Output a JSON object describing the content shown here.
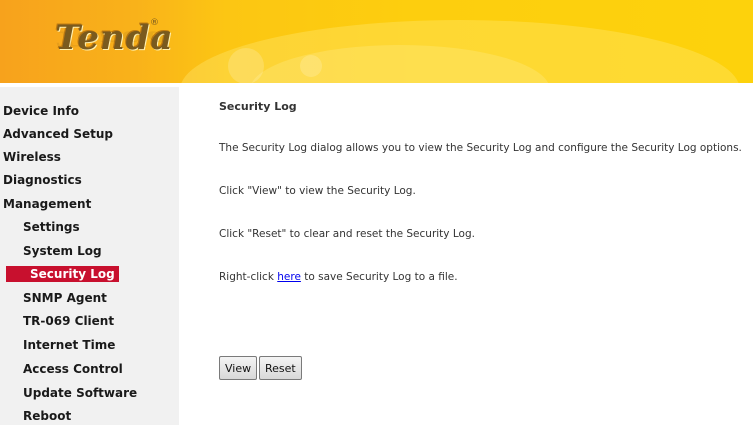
{
  "brand": {
    "logo_text": "Tenda",
    "logo_mark": "®"
  },
  "sidebar": {
    "items": [
      {
        "label": "Device Info",
        "level": "top"
      },
      {
        "label": "Advanced Setup",
        "level": "top"
      },
      {
        "label": "Wireless",
        "level": "top"
      },
      {
        "label": "Diagnostics",
        "level": "top"
      },
      {
        "label": "Management",
        "level": "top"
      },
      {
        "label": "Settings",
        "level": "sub"
      },
      {
        "label": "System Log",
        "level": "sub"
      },
      {
        "label": "Security Log",
        "level": "sub",
        "active": true
      },
      {
        "label": "SNMP Agent",
        "level": "sub"
      },
      {
        "label": "TR-069 Client",
        "level": "sub"
      },
      {
        "label": "Internet Time",
        "level": "sub"
      },
      {
        "label": "Access Control",
        "level": "sub"
      },
      {
        "label": "Update Software",
        "level": "sub"
      },
      {
        "label": "Reboot",
        "level": "sub"
      }
    ]
  },
  "main": {
    "title": "Security Log",
    "description": "The Security Log dialog allows you to view the Security Log and configure the Security Log options.",
    "view_hint": "Click \"View\" to view the Security Log.",
    "reset_hint": "Click \"Reset\" to clear and reset the Security Log.",
    "save_prefix": "Right-click ",
    "save_link": "here",
    "save_suffix": " to save Security Log to a file.",
    "view_button": "View",
    "reset_button": "Reset"
  },
  "colors": {
    "active_nav": "#c8102e",
    "header": "#fdce0e",
    "sidebar_bg": "#f1f1f1"
  }
}
